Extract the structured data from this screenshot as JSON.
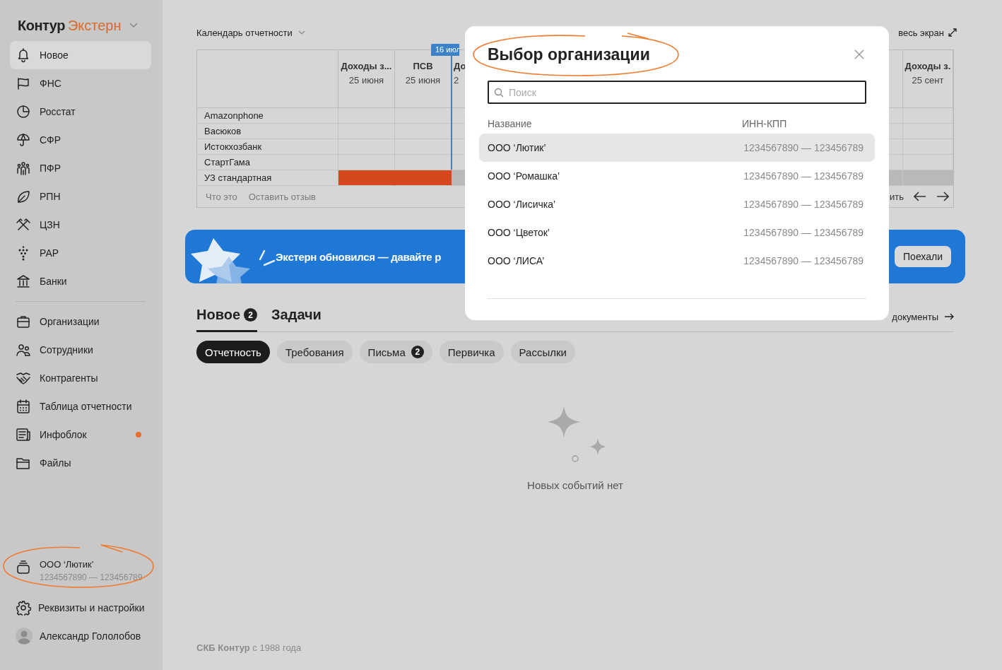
{
  "sidebar": {
    "logo": {
      "brand": "Контур",
      "product": "Экстерн"
    },
    "nav_groups": [
      [
        {
          "label": "Новое",
          "selected": true,
          "unread": false
        },
        {
          "label": "ФНС",
          "selected": false,
          "unread": false
        },
        {
          "label": "Росстат",
          "selected": false,
          "unread": false
        },
        {
          "label": "СФР",
          "selected": false,
          "unread": false
        },
        {
          "label": "ПФР",
          "selected": false,
          "unread": false
        },
        {
          "label": "РПН",
          "selected": false,
          "unread": false
        },
        {
          "label": "ЦЗН",
          "selected": false,
          "unread": false
        },
        {
          "label": "РАР",
          "selected": false,
          "unread": false
        },
        {
          "label": "Банки",
          "selected": false,
          "unread": false
        }
      ],
      [
        {
          "label": "Организации",
          "selected": false,
          "unread": false
        },
        {
          "label": "Сотрудники",
          "selected": false,
          "unread": false
        },
        {
          "label": "Контрагенты",
          "selected": false,
          "unread": false
        },
        {
          "label": "Таблица отчетности",
          "selected": false,
          "unread": false
        },
        {
          "label": "Инфоблок",
          "selected": false,
          "unread": true
        },
        {
          "label": "Файлы",
          "selected": false,
          "unread": false
        }
      ]
    ],
    "organization": {
      "name": "ООО ‘Лютик’",
      "inn_kpp": "1234567890 — 123456789",
      "highlighted": true
    },
    "settings": {
      "label": "Реквизиты и настройки"
    },
    "user": {
      "name": "Александр Гололобов"
    }
  },
  "calendar": {
    "title": "Календарь отчетности",
    "fullscreen_link": "весь экран",
    "today_marker": "16 июл",
    "columns": [
      {
        "title": "Доходы з...",
        "date": "25 июня"
      },
      {
        "title": "ПСВ",
        "date": "25 июня"
      },
      {
        "title": "До",
        "date": "2"
      },
      {
        "title": "Доходы з.",
        "date": "25 сент"
      }
    ],
    "rows": [
      {
        "name": "Amazonphone",
        "has_deadlines": false
      },
      {
        "name": "Васюков",
        "has_deadlines": false
      },
      {
        "name": "Истокхозбанк",
        "has_deadlines": false
      },
      {
        "name": "СтартГама",
        "has_deadlines": false
      },
      {
        "name": "УЗ стандартная",
        "has_deadlines": true
      }
    ],
    "footer_links": [
      "Что это",
      "Оставить отзыв"
    ],
    "footer_right": "ить"
  },
  "banner": {
    "text": "Экстерн обновился — давайте р",
    "button": "Поехали"
  },
  "tabs": [
    {
      "label": "Новое",
      "count": "2",
      "selected": true
    },
    {
      "label": "Задачи",
      "selected": false
    }
  ],
  "all_documents_link": "документы",
  "filters": [
    {
      "label": "Отчетность",
      "selected": true
    },
    {
      "label": "Требования",
      "selected": false
    },
    {
      "label": "Письма",
      "count": "2",
      "selected": false
    },
    {
      "label": "Первичка",
      "selected": false
    },
    {
      "label": "Рассылки",
      "selected": false
    }
  ],
  "empty_state": {
    "text": "Новых событий нет"
  },
  "footer": {
    "text": "**СКБ Контур** с 1988 года"
  },
  "modal": {
    "title": "Выбор организации",
    "title_highlighted": true,
    "search": {
      "placeholder": "Поиск"
    },
    "columns": [
      "Название",
      "ИНН-КПП"
    ],
    "rows": [
      {
        "name": "ООО ‘Лютик’",
        "inn_kpp": "1234567890 — 123456789",
        "selected": true
      },
      {
        "name": "ООО ‘Ромашка’",
        "inn_kpp": "1234567890 — 123456789",
        "selected": false
      },
      {
        "name": "ООО ‘Лисичка’",
        "inn_kpp": "1234567890 — 123456789",
        "selected": false
      },
      {
        "name": "ООО ‘Цветок’",
        "inn_kpp": "1234567890 — 123456789",
        "selected": false
      },
      {
        "name": "ООО ‘ЛИСА’",
        "inn_kpp": "1234567890 — 123456789",
        "selected": false
      }
    ]
  }
}
